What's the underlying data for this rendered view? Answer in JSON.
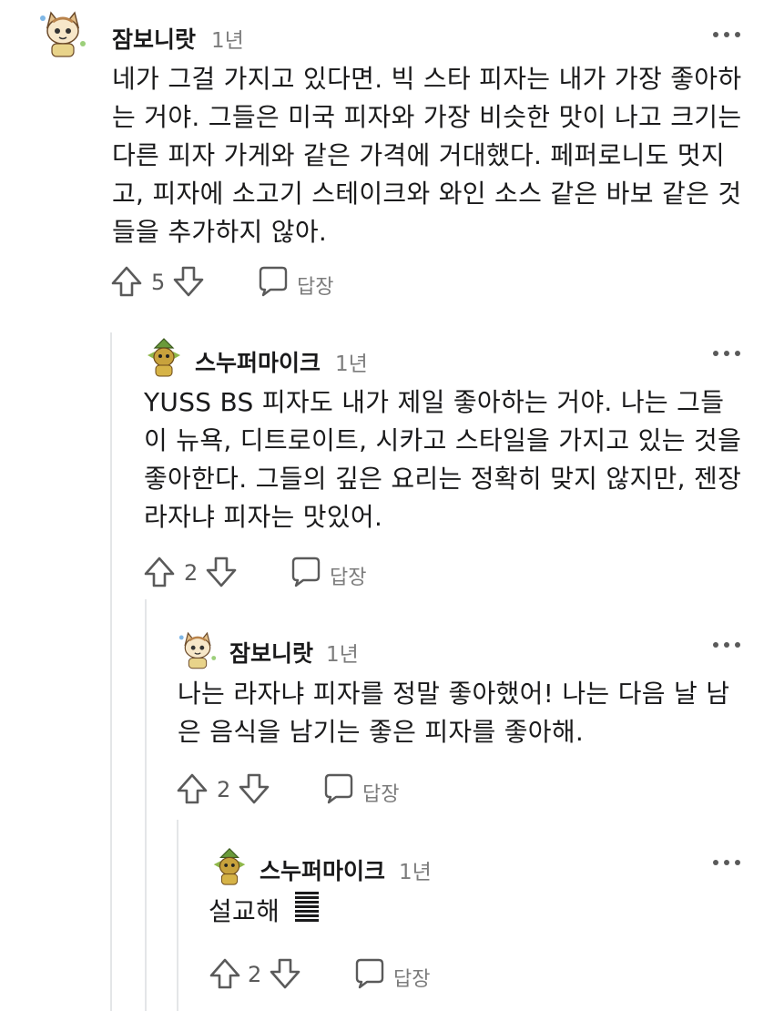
{
  "comments": [
    {
      "username": "잠보니랏",
      "age": "1년",
      "lines": [
        "네가 그걸 가지고 있다면. 빅 스타 피자는 내가 가장 좋아하",
        "는 거야. 그들은 미국 피자와 가장 비슷한 맛이 나고 크기는",
        "다른 피자 가게와 같은 가격에 거대했다. 페퍼로니도 멋지",
        "고, 피자에 소고기 스테이크와 와인 소스 같은 바보 같은 것",
        "들을 추가하지 않아."
      ],
      "votes": "5",
      "reply_label": "답장",
      "avatar": "cat-avatar"
    },
    {
      "username": "스누퍼마이크",
      "age": "1년",
      "lines": [
        "YUSS BS 피자도 내가 제일 좋아하는 거야. 나는 그들",
        "이 뉴욕, 디트로이트, 시카고 스타일을 가지고 있는 것을",
        "좋아한다. 그들의 깊은 요리는 정확히 맞지 않지만, 젠장",
        "라자냐 피자는 맛있어."
      ],
      "votes": "2",
      "reply_label": "답장",
      "avatar": "goblin-avatar"
    },
    {
      "username": "잠보니랏",
      "age": "1년",
      "lines": [
        "나는 라자냐 피자를 정말 좋아했어! 나는 다음 날 남",
        "은 음식을 남기는 좋은 피자를 좋아해."
      ],
      "votes": "2",
      "reply_label": "답장",
      "avatar": "cat-avatar"
    },
    {
      "username": "스누퍼마이크",
      "age": "1년",
      "lines": [
        "설교해"
      ],
      "votes": "2",
      "reply_label": "답장",
      "avatar": "goblin-avatar",
      "trailing_icon": "stacked-bars-icon"
    }
  ]
}
